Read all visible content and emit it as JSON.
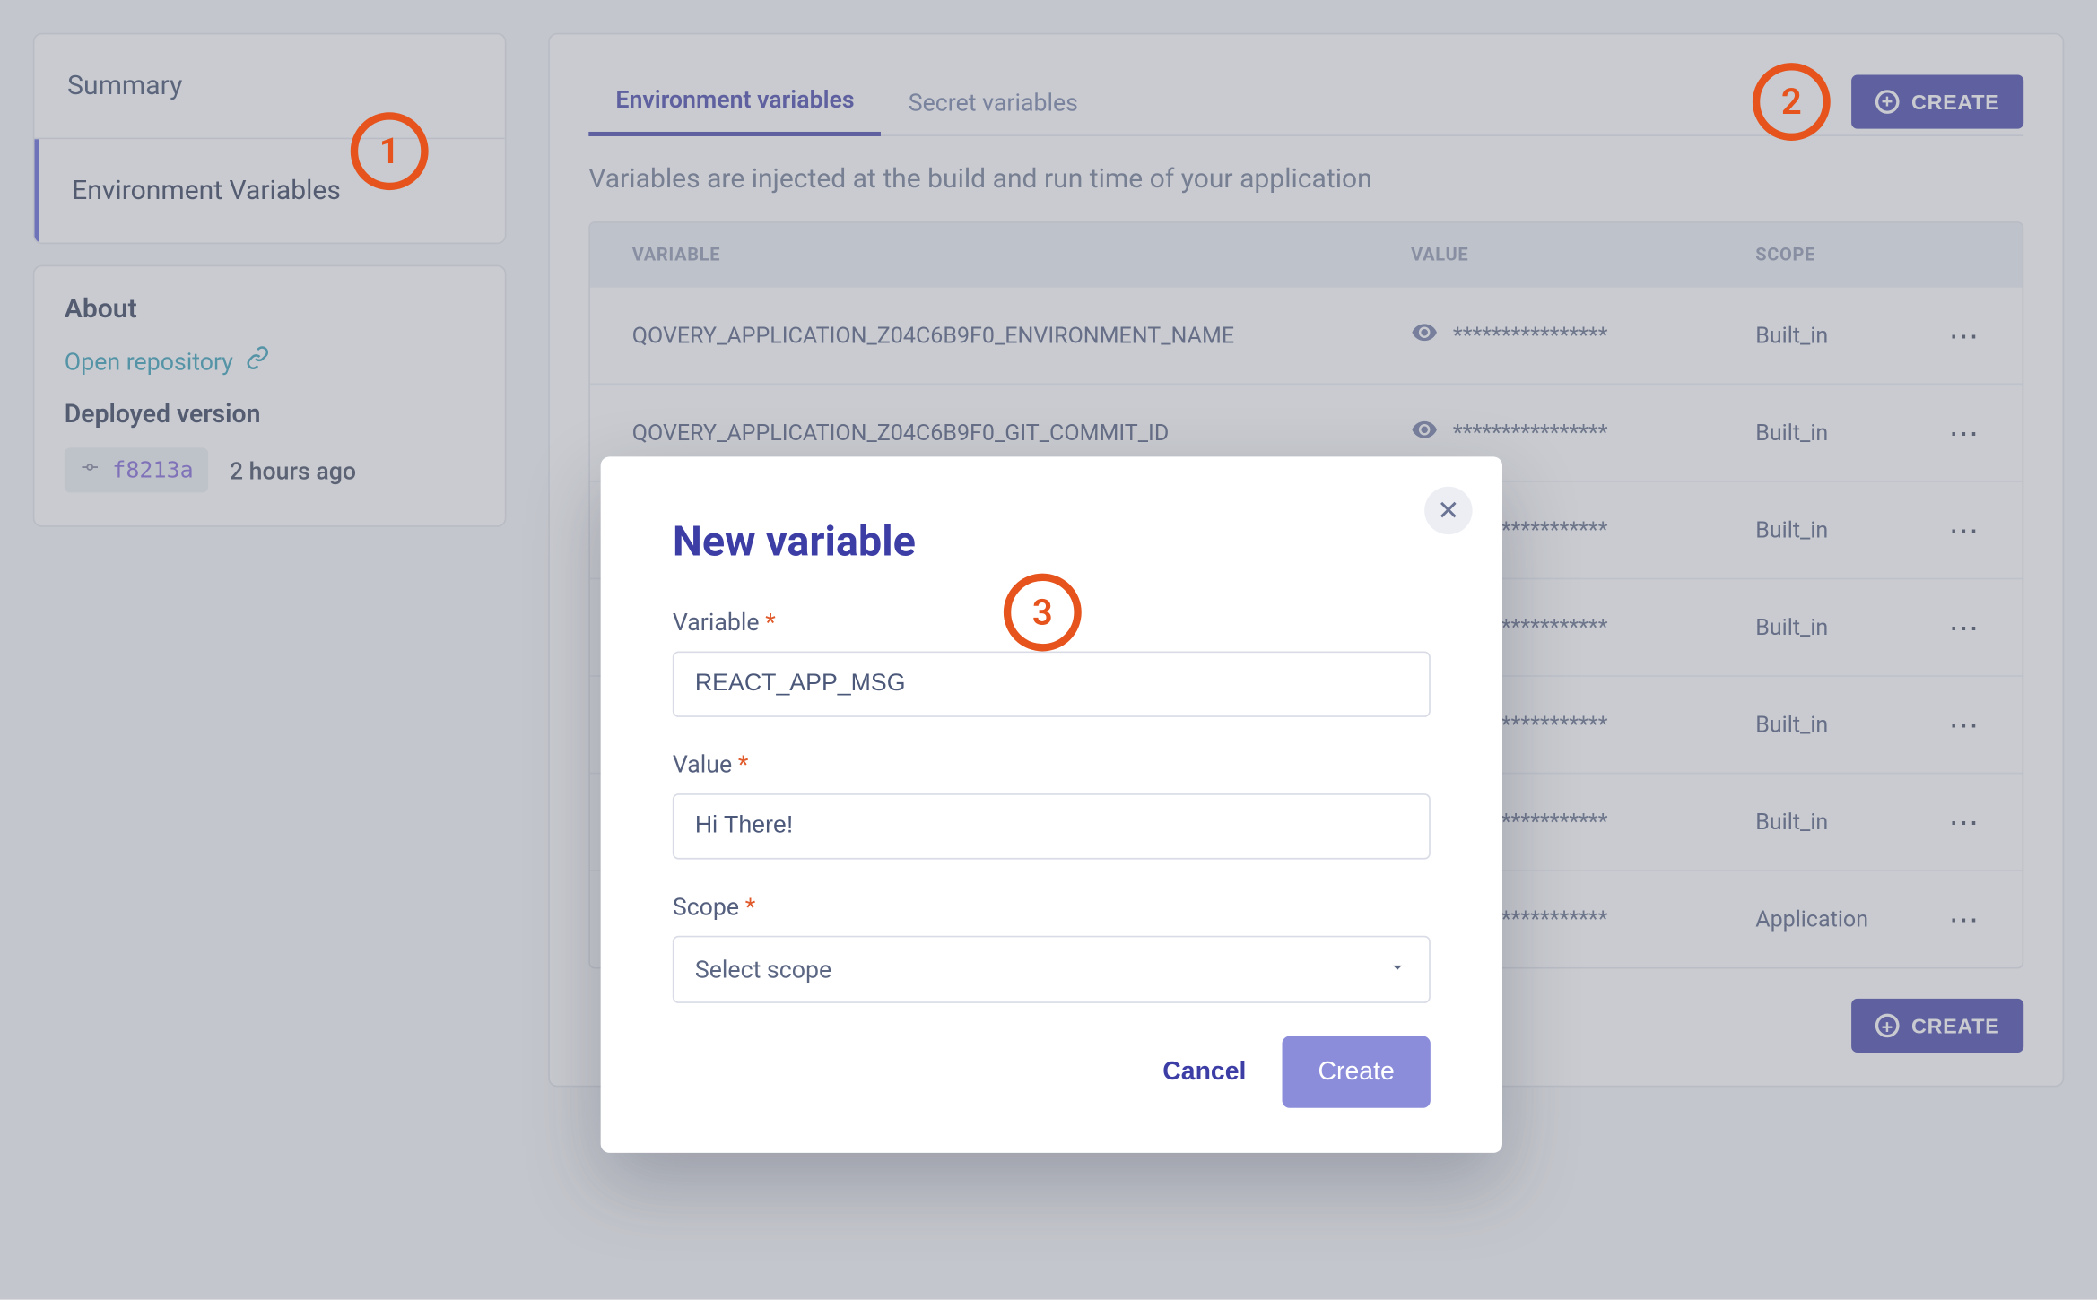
{
  "sidebar": {
    "nav": {
      "summary": "Summary",
      "env_vars": "Environment Variables"
    },
    "about": {
      "heading": "About",
      "open_repo": "Open repository",
      "deployed_label": "Deployed version",
      "commit": "f8213a",
      "time_ago": "2 hours ago"
    }
  },
  "main": {
    "tabs": {
      "env": "Environment variables",
      "secret": "Secret variables"
    },
    "create_button": "CREATE",
    "subheading": "Variables are injected at the build and run time of your application",
    "columns": {
      "variable": "VARIABLE",
      "value": "VALUE",
      "scope": "SCOPE"
    },
    "rows": [
      {
        "name": "QOVERY_APPLICATION_Z04C6B9F0_ENVIRONMENT_NAME",
        "value": "****************",
        "scope": "Built_in"
      },
      {
        "name": "QOVERY_APPLICATION_Z04C6B9F0_GIT_COMMIT_ID",
        "value": "****************",
        "scope": "Built_in"
      },
      {
        "name": "",
        "value": "****************",
        "scope": "Built_in"
      },
      {
        "name": "",
        "value": "****************",
        "scope": "Built_in"
      },
      {
        "name": "",
        "value": "****************",
        "scope": "Built_in"
      },
      {
        "name": "",
        "value": "****************",
        "scope": "Built_in"
      },
      {
        "name": "",
        "value": "****************",
        "scope": "Application"
      }
    ]
  },
  "modal": {
    "title": "New variable",
    "labels": {
      "variable": "Variable",
      "value": "Value",
      "scope": "Scope"
    },
    "values": {
      "variable": "REACT_APP_MSG",
      "value": "Hi There!",
      "scope_placeholder": "Select scope"
    },
    "actions": {
      "cancel": "Cancel",
      "create": "Create"
    }
  },
  "annotations": {
    "one": "1",
    "two": "2",
    "three": "3"
  }
}
